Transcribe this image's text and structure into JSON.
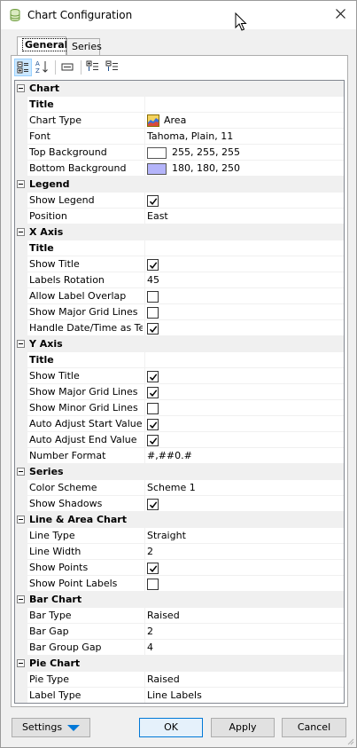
{
  "window": {
    "title": "Chart Configuration"
  },
  "tabs": [
    {
      "label": "General"
    },
    {
      "label": "Series"
    }
  ],
  "grid": {
    "rows": [
      {
        "kind": "cat",
        "label": "Chart"
      },
      {
        "kind": "sub",
        "label": "Title"
      },
      {
        "kind": "prop",
        "label": "Chart Type",
        "type": "icon",
        "icon": "area-chart-icon",
        "value": "Area"
      },
      {
        "kind": "prop",
        "label": "Font",
        "type": "text",
        "value": "Tahoma, Plain, 11"
      },
      {
        "kind": "prop",
        "label": "Top Background",
        "type": "color",
        "color": "#ffffff",
        "value": "255, 255, 255"
      },
      {
        "kind": "prop",
        "label": "Bottom Background",
        "type": "color",
        "color": "#b4b4fa",
        "value": "180, 180, 250"
      },
      {
        "kind": "cat",
        "label": "Legend"
      },
      {
        "kind": "prop",
        "label": "Show Legend",
        "type": "check",
        "checked": true
      },
      {
        "kind": "prop",
        "label": "Position",
        "type": "text",
        "value": "East"
      },
      {
        "kind": "cat",
        "label": "X Axis"
      },
      {
        "kind": "sub",
        "label": "Title"
      },
      {
        "kind": "prop",
        "label": "Show Title",
        "type": "check",
        "checked": true
      },
      {
        "kind": "prop",
        "label": "Labels Rotation",
        "type": "text",
        "value": "45"
      },
      {
        "kind": "prop",
        "label": "Allow Label Overlap",
        "type": "check",
        "checked": false
      },
      {
        "kind": "prop",
        "label": "Show Major Grid Lines",
        "type": "check",
        "checked": false
      },
      {
        "kind": "prop",
        "label": "Handle Date/Time as Text",
        "type": "check",
        "checked": true
      },
      {
        "kind": "cat",
        "label": "Y Axis"
      },
      {
        "kind": "sub",
        "label": "Title"
      },
      {
        "kind": "prop",
        "label": "Show Title",
        "type": "check",
        "checked": true
      },
      {
        "kind": "prop",
        "label": "Show Major Grid Lines",
        "type": "check",
        "checked": true
      },
      {
        "kind": "prop",
        "label": "Show Minor Grid Lines",
        "type": "check",
        "checked": false
      },
      {
        "kind": "prop",
        "label": "Auto Adjust Start Value",
        "type": "check",
        "checked": true
      },
      {
        "kind": "prop",
        "label": "Auto Adjust End Value",
        "type": "check",
        "checked": true
      },
      {
        "kind": "prop",
        "label": "Number Format",
        "type": "text",
        "value": "#,##0.#"
      },
      {
        "kind": "cat",
        "label": "Series"
      },
      {
        "kind": "prop",
        "label": "Color Scheme",
        "type": "text",
        "value": "Scheme 1"
      },
      {
        "kind": "prop",
        "label": "Show Shadows",
        "type": "check",
        "checked": true
      },
      {
        "kind": "cat",
        "label": "Line & Area Chart"
      },
      {
        "kind": "prop",
        "label": "Line Type",
        "type": "text",
        "value": "Straight"
      },
      {
        "kind": "prop",
        "label": "Line Width",
        "type": "text",
        "value": "2"
      },
      {
        "kind": "prop",
        "label": "Show Points",
        "type": "check",
        "checked": true
      },
      {
        "kind": "prop",
        "label": "Show Point Labels",
        "type": "check",
        "checked": false
      },
      {
        "kind": "cat",
        "label": "Bar Chart"
      },
      {
        "kind": "prop",
        "label": "Bar Type",
        "type": "text",
        "value": "Raised"
      },
      {
        "kind": "prop",
        "label": "Bar Gap",
        "type": "text",
        "value": "2"
      },
      {
        "kind": "prop",
        "label": "Bar Group Gap",
        "type": "text",
        "value": "4"
      },
      {
        "kind": "cat",
        "label": "Pie Chart"
      },
      {
        "kind": "prop",
        "label": "Pie Type",
        "type": "text",
        "value": "Raised"
      },
      {
        "kind": "prop",
        "label": "Label Type",
        "type": "text",
        "value": "Line Labels"
      }
    ]
  },
  "buttons": {
    "settings": "Settings",
    "ok": "OK",
    "apply": "Apply",
    "cancel": "Cancel"
  },
  "colors": {
    "accent": "#0078d7",
    "category_bg": "#f0f0f0"
  }
}
